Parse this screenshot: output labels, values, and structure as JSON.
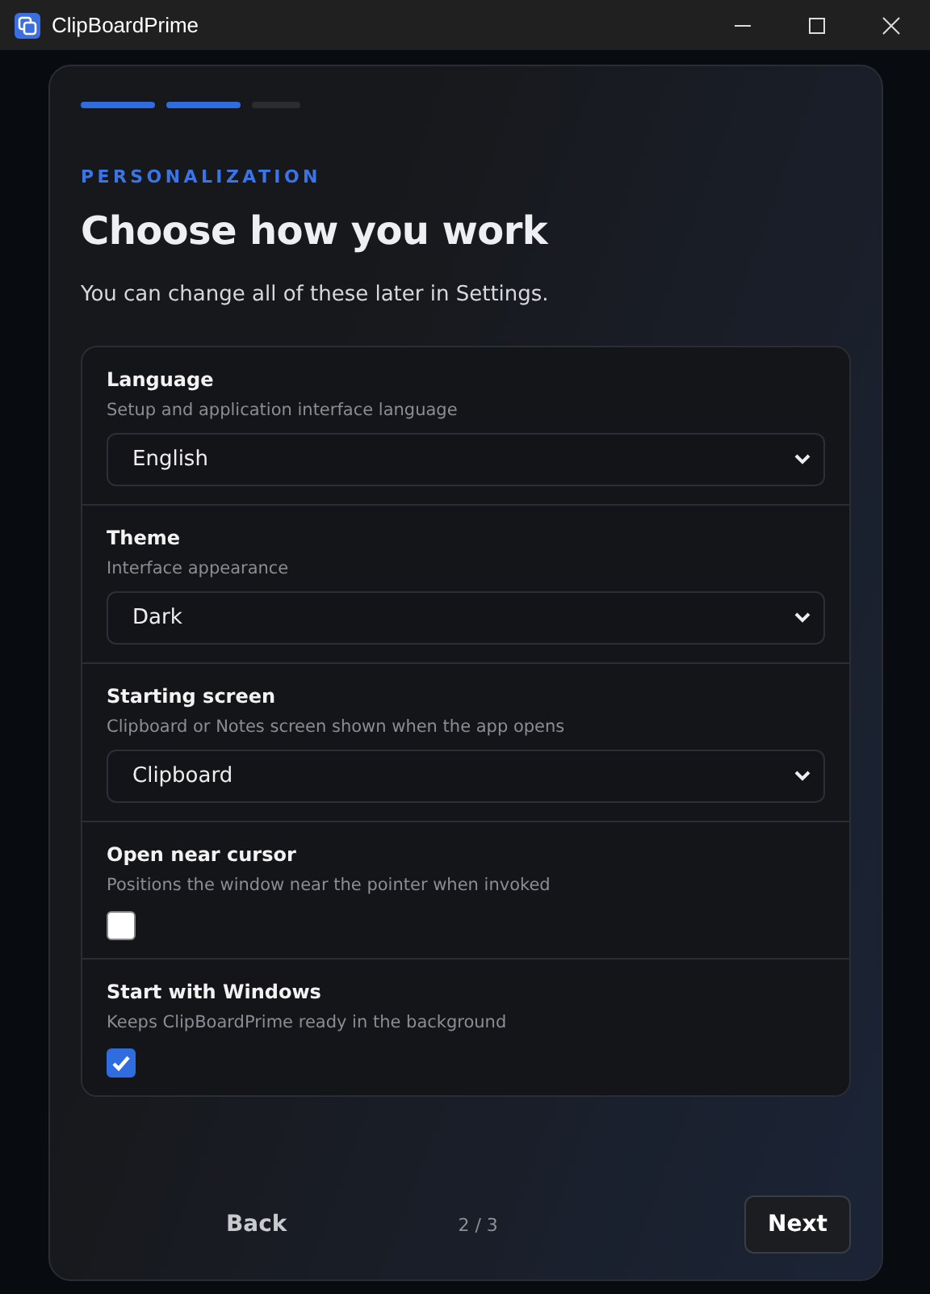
{
  "window": {
    "title": "ClipBoardPrime"
  },
  "progress": [
    {
      "done": true
    },
    {
      "done": true
    },
    {
      "done": false
    }
  ],
  "eyebrow": "PERSONALIZATION",
  "title": "Choose how you work",
  "subtitle": "You can change all of these later in Settings.",
  "settings": [
    {
      "kind": "select",
      "label": "Language",
      "description": "Setup and application interface language",
      "value": "English"
    },
    {
      "kind": "select",
      "label": "Theme",
      "description": "Interface appearance",
      "value": "Dark"
    },
    {
      "kind": "select",
      "label": "Starting screen",
      "description": "Clipboard or Notes screen shown when the app opens",
      "value": "Clipboard"
    },
    {
      "kind": "checkbox",
      "label": "Open near cursor",
      "description": "Positions the window near the pointer when invoked",
      "checked": false
    },
    {
      "kind": "checkbox",
      "label": "Start with Windows",
      "description": "Keeps ClipBoardPrime ready in the background",
      "checked": true
    }
  ],
  "footer": {
    "back": "Back",
    "step": "2 / 3",
    "next": "Next"
  }
}
